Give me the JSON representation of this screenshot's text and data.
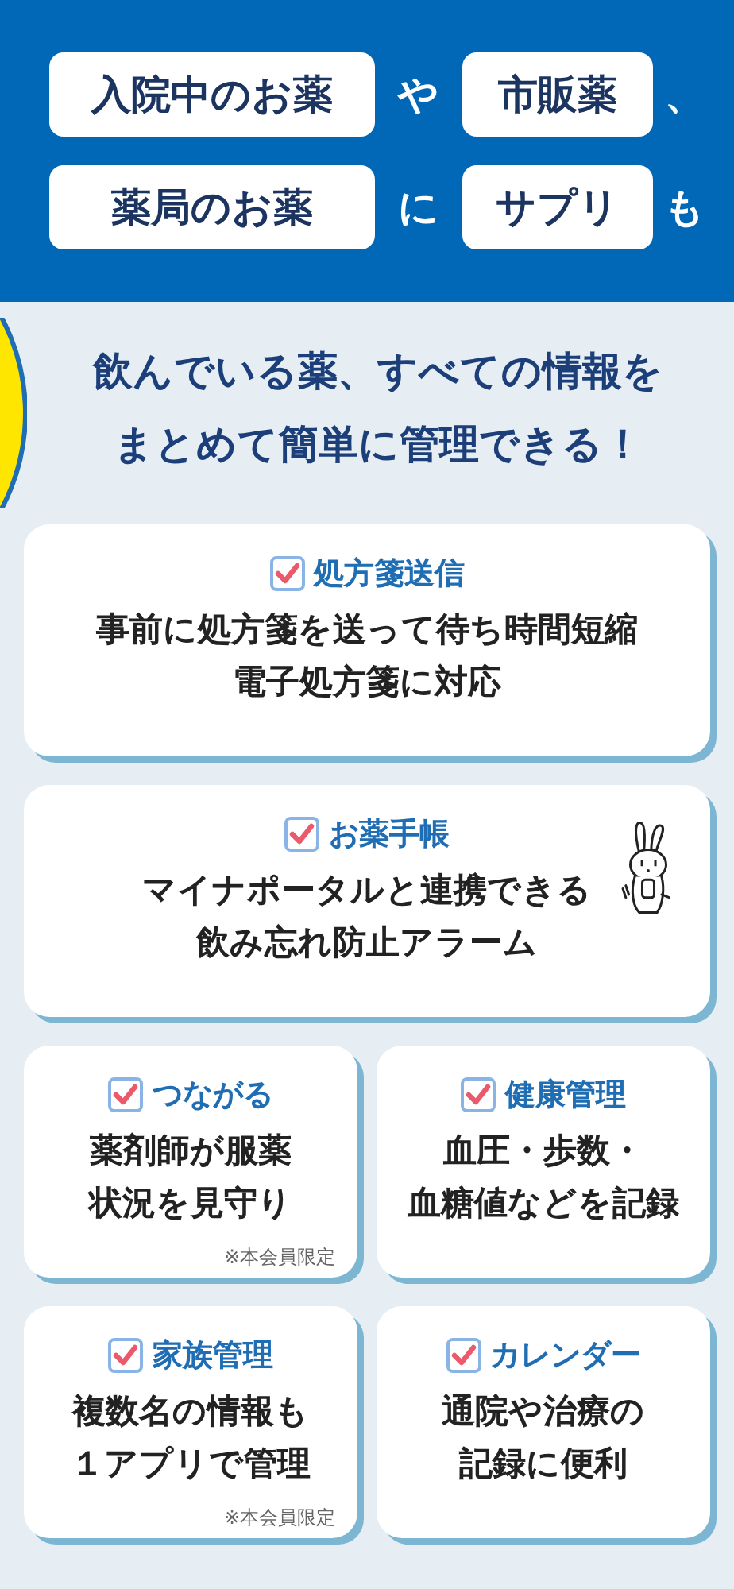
{
  "header": {
    "rows": [
      [
        {
          "kind": "pill",
          "text": "入院中のお薬"
        },
        {
          "kind": "text",
          "text": "や"
        },
        {
          "kind": "pill",
          "text": "市販薬"
        },
        {
          "kind": "text",
          "text": "、"
        }
      ],
      [
        {
          "kind": "pill",
          "text": "薬局のお薬"
        },
        {
          "kind": "text",
          "text": "に"
        },
        {
          "kind": "pill",
          "text": "サプリ"
        },
        {
          "kind": "text",
          "text": "も"
        }
      ]
    ]
  },
  "tagline": [
    "飲んでいる薬、すべての情報を",
    "まとめて簡単に管理できる！"
  ],
  "features": [
    {
      "kind": "wide",
      "checked": true,
      "title": "処方箋送信",
      "lines": [
        "事前に処方箋を送って待ち時間短縮",
        "電子処方箋に対応"
      ],
      "mascot": false
    },
    {
      "kind": "wide",
      "checked": true,
      "title": "お薬手帳",
      "lines": [
        "マイナポータルと連携できる",
        "飲み忘れ防止アラーム"
      ],
      "mascot": true
    },
    {
      "kind": "half",
      "checked": true,
      "title": "つながる",
      "lines": [
        "薬剤師が服薬",
        "状況を見守り"
      ],
      "note": "※本会員限定"
    },
    {
      "kind": "half",
      "checked": true,
      "title": "健康管理",
      "lines": [
        "血圧・歩数・",
        "血糖値などを記録"
      ]
    },
    {
      "kind": "half",
      "checked": true,
      "title": "家族管理",
      "lines": [
        "複数名の情報も",
        "１アプリで管理"
      ],
      "note": "※本会員限定"
    },
    {
      "kind": "half",
      "checked": true,
      "title": "カレンダー",
      "lines": [
        "通院や治療の",
        "記録に便利"
      ]
    }
  ]
}
